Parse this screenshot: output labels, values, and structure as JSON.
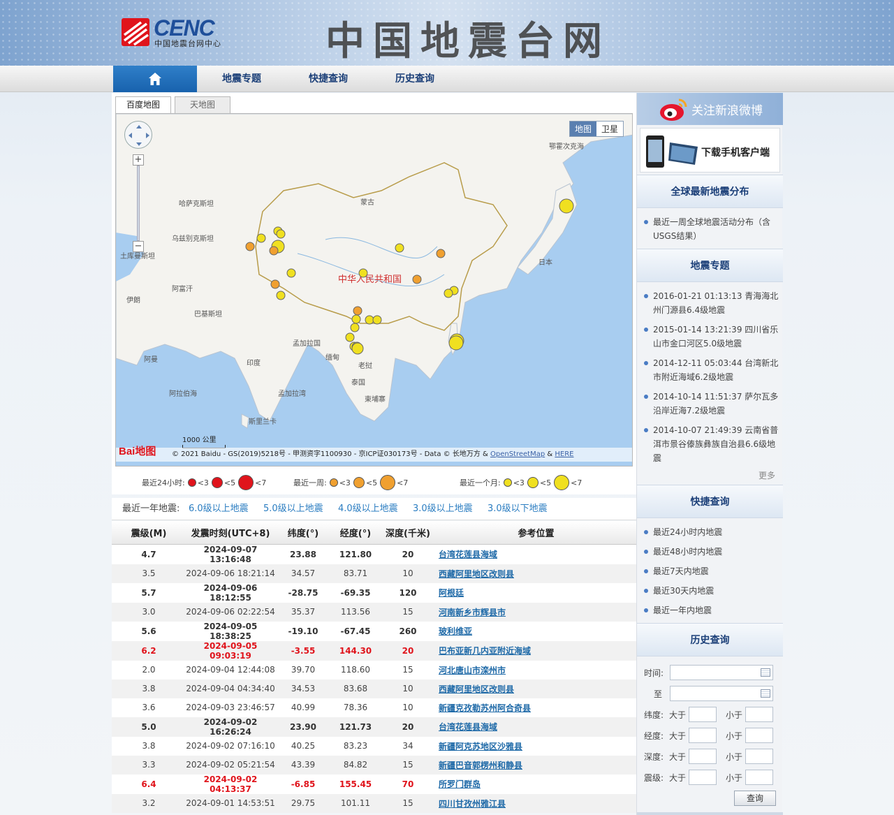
{
  "header": {
    "logo_text": "CENC",
    "logo_sub": "中国地震台网中心",
    "site_title": "中国地震台网"
  },
  "nav": {
    "home_icon": "home-icon",
    "items": [
      "地震专题",
      "快捷查询",
      "历史查询"
    ]
  },
  "map": {
    "tabs": [
      "百度地图",
      "天地图"
    ],
    "maptype": [
      "地图",
      "卫星"
    ],
    "labels": {
      "okhotsk": "鄂霍次克海",
      "kazakhstan": "哈萨克斯坦",
      "mongolia": "蒙古",
      "uzbekistan": "乌兹别克斯坦",
      "turkmenistan": "土库曼斯坦",
      "afghanistan": "阿富汗",
      "iran": "伊朗",
      "pakistan": "巴基斯坦",
      "china": "中华人民共和国",
      "japan": "日本",
      "bangladesh": "孟加拉国",
      "myanmar": "缅甸",
      "india": "印度",
      "laos": "老挝",
      "thailand": "泰国",
      "cambodia": "柬埔寨",
      "oman": "阿曼",
      "arabian_sea": "阿拉伯海",
      "bay_of_bengal": "孟加拉湾",
      "sri_lanka": "斯里兰卡"
    },
    "scale_label": "1000 公里",
    "baidu_logo": "Bai地图",
    "copyright_text": "© 2021 Baidu - GS(2019)5218号 - 甲测资字1100930 - 京ICP证030173号 - Data © 长地万方 &",
    "copyright_links": [
      "OpenStreetMap",
      "HERE"
    ],
    "copyright_amp": "&"
  },
  "legend": {
    "groups": [
      {
        "label": "最近24小时:",
        "color": "#e0141c",
        "items": [
          "<3",
          "<5",
          "<7"
        ]
      },
      {
        "label": "最近一周:",
        "color": "#f0a030",
        "items": [
          "<3",
          "<5",
          "<7"
        ]
      },
      {
        "label": "最近一个月:",
        "color": "#f0e020",
        "items": [
          "<3",
          "<5",
          "<7"
        ]
      }
    ]
  },
  "year_bar": {
    "label": "最近一年地震:",
    "links": [
      "6.0级以上地震",
      "5.0级以上地震",
      "4.0级以上地震",
      "3.0级以上地震",
      "3.0级以下地震"
    ]
  },
  "table": {
    "headers": [
      "震级(M)",
      "发震时刻(UTC+8)",
      "纬度(°)",
      "经度(°)",
      "深度(千米)",
      "参考位置"
    ],
    "rows": [
      {
        "m": "4.7",
        "t": "2024-09-07 13:16:48",
        "lat": "23.88",
        "lon": "121.80",
        "d": "20",
        "loc": "台湾花莲县海域",
        "style": "bold"
      },
      {
        "m": "3.5",
        "t": "2024-09-06 18:21:14",
        "lat": "34.57",
        "lon": "83.71",
        "d": "10",
        "loc": "西藏阿里地区改则县",
        "style": "normal"
      },
      {
        "m": "5.7",
        "t": "2024-09-06 18:12:55",
        "lat": "-28.75",
        "lon": "-69.35",
        "d": "120",
        "loc": "阿根廷",
        "style": "bold"
      },
      {
        "m": "3.0",
        "t": "2024-09-06 02:22:54",
        "lat": "35.37",
        "lon": "113.56",
        "d": "15",
        "loc": "河南新乡市辉县市",
        "style": "normal"
      },
      {
        "m": "5.6",
        "t": "2024-09-05 18:38:25",
        "lat": "-19.10",
        "lon": "-67.45",
        "d": "260",
        "loc": "玻利维亚",
        "style": "bold"
      },
      {
        "m": "6.2",
        "t": "2024-09-05 09:03:19",
        "lat": "-3.55",
        "lon": "144.30",
        "d": "20",
        "loc": "巴布亚新几内亚附近海域",
        "style": "red"
      },
      {
        "m": "2.0",
        "t": "2024-09-04 12:44:08",
        "lat": "39.70",
        "lon": "118.60",
        "d": "15",
        "loc": "河北唐山市滦州市",
        "style": "normal"
      },
      {
        "m": "3.8",
        "t": "2024-09-04 04:34:40",
        "lat": "34.53",
        "lon": "83.68",
        "d": "10",
        "loc": "西藏阿里地区改则县",
        "style": "normal"
      },
      {
        "m": "3.6",
        "t": "2024-09-03 23:46:57",
        "lat": "40.99",
        "lon": "78.36",
        "d": "10",
        "loc": "新疆克孜勒苏州阿合奇县",
        "style": "normal"
      },
      {
        "m": "5.0",
        "t": "2024-09-02 16:26:24",
        "lat": "23.90",
        "lon": "121.73",
        "d": "20",
        "loc": "台湾花莲县海域",
        "style": "bold"
      },
      {
        "m": "3.8",
        "t": "2024-09-02 07:16:10",
        "lat": "40.25",
        "lon": "83.23",
        "d": "34",
        "loc": "新疆阿克苏地区沙雅县",
        "style": "normal"
      },
      {
        "m": "3.3",
        "t": "2024-09-02 05:21:54",
        "lat": "43.39",
        "lon": "84.82",
        "d": "15",
        "loc": "新疆巴音郭楞州和静县",
        "style": "normal"
      },
      {
        "m": "6.4",
        "t": "2024-09-02 04:13:37",
        "lat": "-6.85",
        "lon": "155.45",
        "d": "70",
        "loc": "所罗门群岛",
        "style": "red"
      },
      {
        "m": "3.2",
        "t": "2024-09-01 14:53:51",
        "lat": "29.75",
        "lon": "101.11",
        "d": "15",
        "loc": "四川甘孜州雅江县",
        "style": "normal"
      }
    ]
  },
  "sidebar": {
    "weibo": {
      "icon": "weibo-icon",
      "text": "关注新浪微博"
    },
    "app": {
      "icon": "phone-icon",
      "text": "下载手机客户端"
    },
    "global": {
      "title": "全球最新地震分布",
      "items": [
        "最近一周全球地震活动分布（含USGS结果）"
      ]
    },
    "topics": {
      "title": "地震专题",
      "items": [
        "2016-01-21 01:13:13 青海海北州门源县6.4级地震",
        "2015-01-14 13:21:39 四川省乐山市金口河区5.0级地震",
        "2014-12-11 05:03:44 台湾新北市附近海域6.2级地震",
        "2014-10-14 11:51:37 萨尔瓦多沿岸近海7.2级地震",
        "2014-10-07 21:49:39 云南省普洱市景谷傣族彝族自治县6.6级地震"
      ],
      "more": "更多"
    },
    "quick": {
      "title": "快捷查询",
      "items": [
        "最近24小时内地震",
        "最近48小时内地震",
        "最近7天内地震",
        "最近30天内地震",
        "最近一年内地震"
      ]
    },
    "history": {
      "title": "历史查询",
      "time_label": "时间:",
      "to_label": "至",
      "rows": [
        {
          "label": "纬度:",
          "gt": "大于",
          "lt": "小于"
        },
        {
          "label": "经度:",
          "gt": "大于",
          "lt": "小于"
        },
        {
          "label": "深度:",
          "gt": "大于",
          "lt": "小于"
        },
        {
          "label": "震级:",
          "gt": "大于",
          "lt": "小于"
        }
      ],
      "button": "查询"
    }
  }
}
